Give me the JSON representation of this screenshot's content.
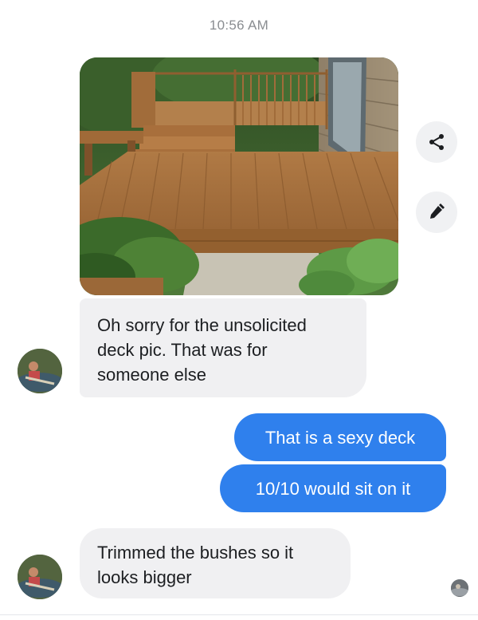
{
  "header": {
    "timestamp": "10:56 AM"
  },
  "attachment": {
    "type": "photo",
    "subject": "wooden-deck-photo"
  },
  "actions": {
    "share_icon": "share-icon",
    "edit_icon": "edit-pencil-icon"
  },
  "messages": [
    {
      "from": "contact",
      "lines": [
        "Oh sorry for the unsolicited",
        "deck pic. That was for",
        "someone else"
      ]
    },
    {
      "from": "me",
      "lines": [
        "That is a sexy deck"
      ]
    },
    {
      "from": "me",
      "lines": [
        "10/10 would sit on it"
      ]
    },
    {
      "from": "contact",
      "lines": [
        "Trimmed the bushes so it",
        "looks bigger"
      ]
    }
  ],
  "colors": {
    "outgoing_bubble": "#2f80ed",
    "incoming_bubble": "#f0f0f2",
    "timestamp_text": "#8a8d91"
  }
}
